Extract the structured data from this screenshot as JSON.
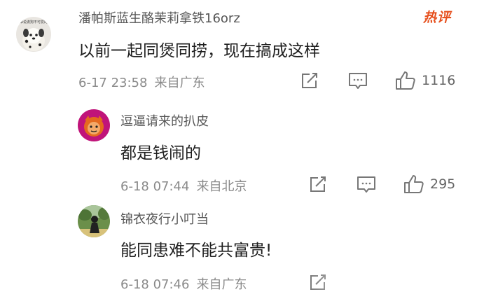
{
  "comments": [
    {
      "user": "潘帕斯蓝生酪茉莉拿铁16orz",
      "avatar_text": "谁说诶狗不可爱的",
      "text": "以前一起同煲同捞，现在搞成这样",
      "time": "6-17 23:58",
      "location": "来自广东",
      "likes": "1116",
      "badge": "热评"
    },
    {
      "user": "逗逼请来的扒皮",
      "text": "都是钱闹的",
      "time": "6-18 07:44",
      "location": "来自北京",
      "likes": "295"
    },
    {
      "user": "锦衣夜行小叮当",
      "text": "能同患难不能共富贵!",
      "time": "6-18 07:46",
      "location": "来自广东"
    }
  ],
  "icons": {
    "forward": "share-edit-icon",
    "comment": "comment-icon",
    "like": "thumbs-up-icon"
  },
  "colors": {
    "hot_badge": "#e6501e",
    "meta_text": "#8a8a8a",
    "icon_stroke": "#777777"
  }
}
